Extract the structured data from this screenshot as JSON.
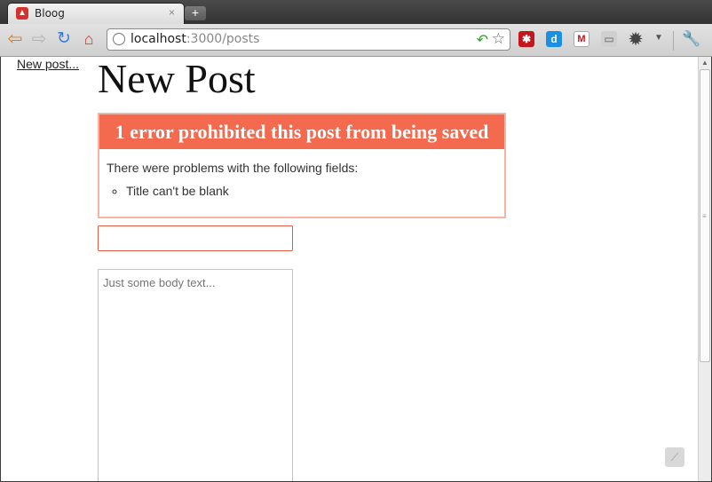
{
  "browser": {
    "tab_title": "Bloog",
    "tab_close": "×",
    "new_tab": "+",
    "url_host": "localhost",
    "url_path": ":3000/posts",
    "icons": {
      "back": "back-arrow-icon",
      "forward": "forward-arrow-icon",
      "reload": "reload-icon",
      "home": "home-icon",
      "star": "bookmark-star-icon",
      "wrench": "wrench-icon"
    },
    "colors": {
      "tab_favicon": "#d4322c",
      "back_arrow": "#e07a12",
      "reload": "#3a7bd5"
    }
  },
  "page": {
    "nav_link": "New post...",
    "title": "New Post",
    "errors": {
      "heading": "1 error prohibited this post from being saved",
      "intro": "There were problems with the following fields:",
      "items": [
        "Title can't be blank"
      ],
      "colors": {
        "heading_bg": "#f36a4f",
        "border": "#f3b4a5"
      }
    },
    "form": {
      "title_value": "",
      "body_placeholder": "Just some body text..."
    }
  }
}
